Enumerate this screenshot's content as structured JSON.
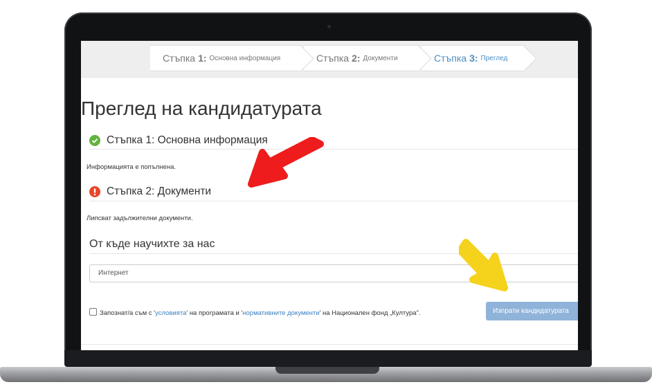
{
  "wizard": {
    "steps": [
      {
        "name": "Стъпка",
        "num": "1:",
        "desc": "Основна информация"
      },
      {
        "name": "Стъпка",
        "num": "2:",
        "desc": "Документи"
      },
      {
        "name": "Стъпка",
        "num": "3:",
        "desc": "Преглед"
      }
    ]
  },
  "page": {
    "title": "Преглед на кандидатурата"
  },
  "sections": {
    "step1": {
      "heading": "Стъпка 1: Основна информация",
      "status_text": "Информацията е попълнена.",
      "icon": "check-circle-icon",
      "color": "#62b33f"
    },
    "step2": {
      "heading": "Стъпка 2: Документи",
      "status_text": "Липсват задължителни документи.",
      "icon": "exclamation-circle-icon",
      "color": "#e8452a"
    },
    "source": {
      "heading": "От къде научихте за нас",
      "selected_value": "Интернет"
    }
  },
  "terms": {
    "text_before": "Запознат/а съм с '",
    "link1": "условията",
    "text_middle": "' на програмата и '",
    "link2": "нормативните документи",
    "text_after": "' на Национален фонд „Култура\"."
  },
  "submit": {
    "label": "Изпрати кандидатурата"
  },
  "annotations": {
    "red_arrow_color": "#ee1c1c",
    "yellow_arrow_color": "#f5d21b"
  },
  "colors": {
    "active_step": "#4a8ec2",
    "link": "#3b7fc0",
    "button": "#8fb3d9"
  }
}
